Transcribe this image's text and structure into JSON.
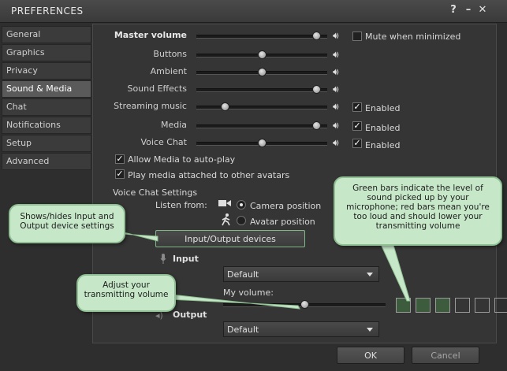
{
  "window": {
    "title": "PREFERENCES",
    "help_label": "?",
    "minimize_label": "–",
    "close_label": "✕"
  },
  "tabs": [
    "General",
    "Graphics",
    "Privacy",
    "Sound & Media",
    "Chat",
    "Notifications",
    "Setup",
    "Advanced"
  ],
  "active_tab": "Sound & Media",
  "volumes": {
    "master": {
      "label": "Master volume",
      "level": 0.95
    },
    "buttons": {
      "label": "Buttons",
      "level": 0.5
    },
    "ambient": {
      "label": "Ambient",
      "level": 0.5
    },
    "effects": {
      "label": "Sound Effects",
      "level": 0.95
    },
    "streaming": {
      "label": "Streaming music",
      "level": 0.2
    },
    "media": {
      "label": "Media",
      "level": 0.95
    },
    "voice": {
      "label": "Voice Chat",
      "level": 0.5
    }
  },
  "mute_minimized": {
    "label": "Mute when minimized",
    "checked": false
  },
  "enabled_label": "Enabled",
  "allow_autoplay": {
    "label": "Allow Media to auto-play",
    "checked": true
  },
  "play_attached": {
    "label": "Play media attached to other avatars",
    "checked": true
  },
  "voice_settings": {
    "heading": "Voice Chat Settings",
    "listen_from": "Listen from:",
    "camera_position": "Camera position",
    "avatar_position": "Avatar position",
    "selected": "camera",
    "io_button": "Input/Output devices"
  },
  "input": {
    "heading": "Input",
    "device": "Default",
    "my_volume_label": "My volume:",
    "volume_level": 0.5
  },
  "output": {
    "heading": "Output",
    "device": "Default"
  },
  "level_indicator": {
    "green_bars": 3,
    "total_bars": 6
  },
  "buttons": {
    "ok": "OK",
    "cancel": "Cancel"
  },
  "callouts": {
    "io": "Shows/hides Input and Output device settings",
    "volume": "Adjust your transmitting volume",
    "bars": "Green bars indicate the level of sound picked up by your microphone; red bars mean you're too loud and should lower your transmitting volume"
  },
  "colors": {
    "callout_bg": "#c6e8c8",
    "level_green": "#3d5c3d",
    "active_tab": "#5a5a5a"
  }
}
